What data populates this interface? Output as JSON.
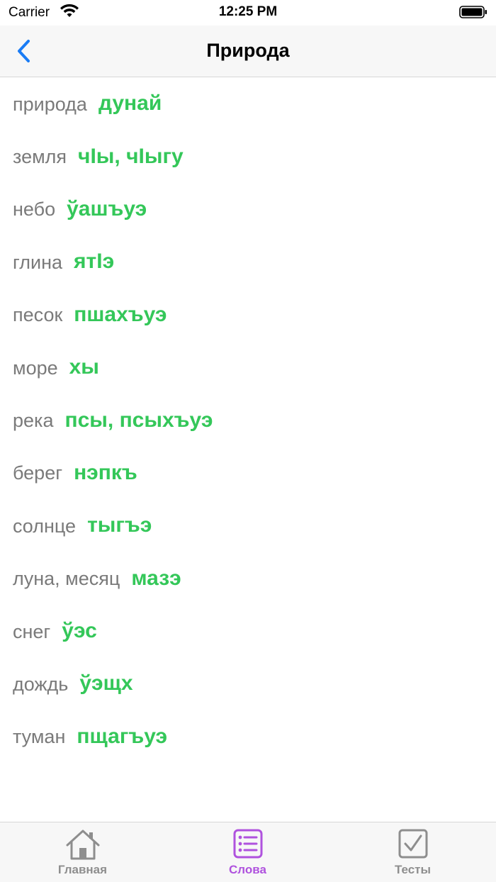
{
  "status_bar": {
    "carrier": "Carrier",
    "time": "12:25 PM"
  },
  "nav": {
    "title": "Природа",
    "back_icon": "chevron-left-icon"
  },
  "colors": {
    "accent_blue": "#1a7cf5",
    "translation_green": "#34c759",
    "tab_active_purple": "#af52de",
    "tab_inactive_gray": "#8e8e8e"
  },
  "words": [
    {
      "ru": "природа",
      "tr": "дунай"
    },
    {
      "ru": "земля",
      "tr": "чІы, чІыгу"
    },
    {
      "ru": "небо",
      "tr": "ўашъуэ"
    },
    {
      "ru": "глина",
      "tr": "ятІэ"
    },
    {
      "ru": "песок",
      "tr": "пшахъуэ"
    },
    {
      "ru": "море",
      "tr": "хы"
    },
    {
      "ru": "река",
      "tr": "псы, псыхъуэ"
    },
    {
      "ru": "берег",
      "tr": "нэпкъ"
    },
    {
      "ru": "солнце",
      "tr": "тыгъэ"
    },
    {
      "ru": "луна, месяц",
      "tr": "мазэ"
    },
    {
      "ru": "снег",
      "tr": "ўэс"
    },
    {
      "ru": "дождь",
      "tr": "ўэщх"
    },
    {
      "ru": "туман",
      "tr": "пщагъуэ"
    }
  ],
  "tabs": [
    {
      "label": "Главная",
      "icon": "house-icon",
      "active": false
    },
    {
      "label": "Слова",
      "icon": "list-icon",
      "active": true
    },
    {
      "label": "Тесты",
      "icon": "checkbox-icon",
      "active": false
    }
  ]
}
